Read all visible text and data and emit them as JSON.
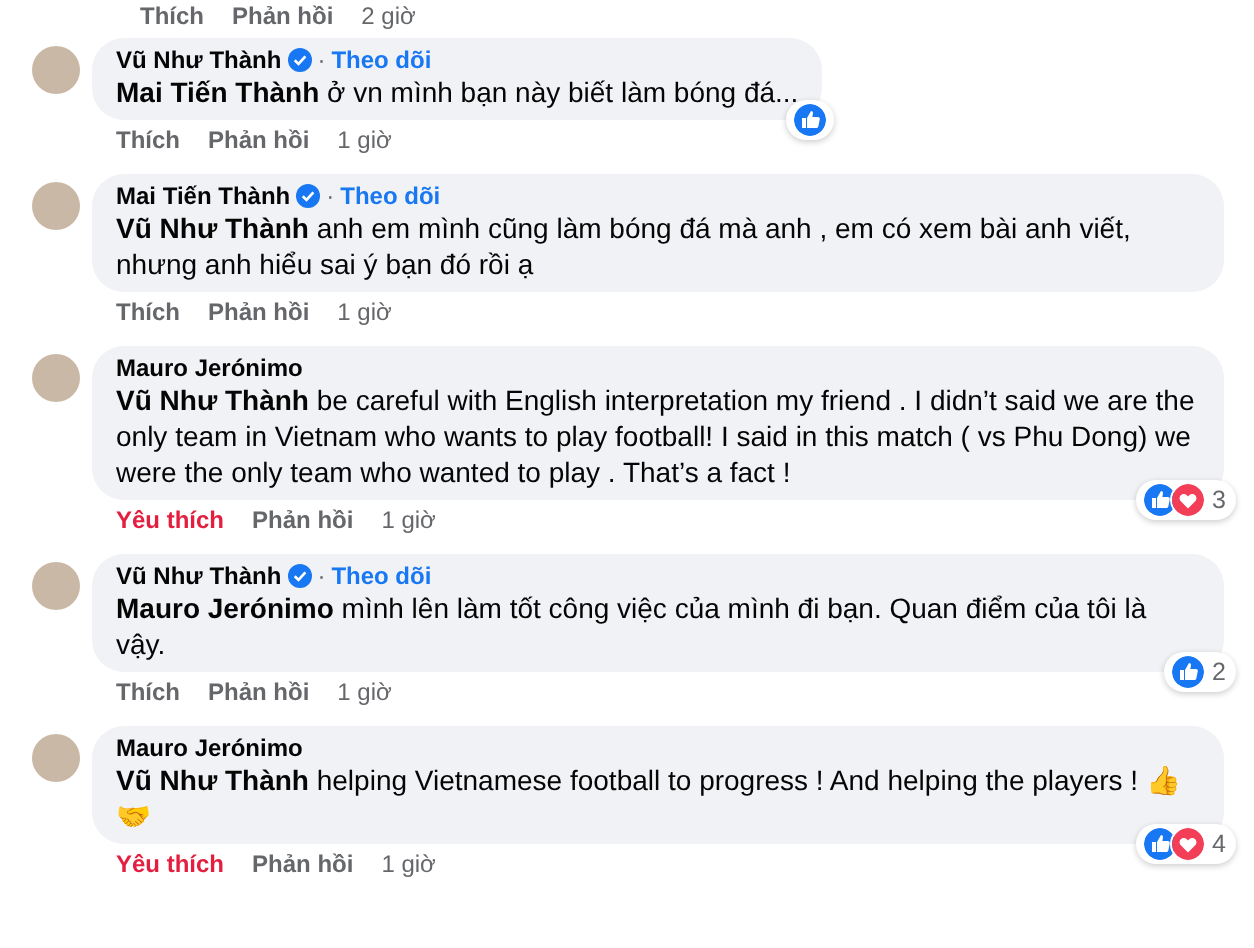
{
  "top_actions": {
    "like_label": "Thích",
    "like_active": false,
    "reply_label": "Phản hồi",
    "time": "2 giờ"
  },
  "comments": [
    {
      "author": "Vũ Như Thành",
      "verified": true,
      "separator": "·",
      "follow_label": "Theo dõi",
      "text": "**Mai Tiến Thành** ở vn mình bạn này biết làm bóng đá...",
      "actions": {
        "like_label": "Thích",
        "like_active": false,
        "reply_label": "Phản hồi",
        "time": "1 giờ"
      },
      "reactions": [
        {
          "kind": "like"
        }
      ]
    },
    {
      "author": "Mai Tiến Thành",
      "verified": true,
      "separator": "·",
      "follow_label": "Theo dõi",
      "text": "**Vũ Như Thành** anh em mình cũng làm bóng đá mà anh , em có xem bài anh viết, nhưng anh hiểu sai ý bạn đó rồi ạ",
      "actions": {
        "like_label": "Thích",
        "like_active": false,
        "reply_label": "Phản hồi",
        "time": "1 giờ"
      }
    },
    {
      "author": "Mauro Jerónimo",
      "verified": false,
      "text": "**Vũ Như Thành** be careful with English interpretation my friend . I didn’t said we are the only team in Vietnam who wants to play football! I said in this match ( vs Phu Dong) we were the only team who wanted to play . That’s a fact !",
      "actions": {
        "like_label": "Yêu thích",
        "like_active": true,
        "reply_label": "Phản hồi",
        "time": "1 giờ"
      },
      "reactions": [
        {
          "kind": "like"
        },
        {
          "kind": "love"
        }
      ],
      "reaction_count": "3"
    },
    {
      "author": "Vũ Như Thành",
      "verified": true,
      "separator": "·",
      "follow_label": "Theo dõi",
      "text": "**Mauro Jerónimo** mình lên làm tốt công việc của mình đi bạn. Quan điểm của tôi là vậy.",
      "actions": {
        "like_label": "Thích",
        "like_active": false,
        "reply_label": "Phản hồi",
        "time": "1 giờ"
      },
      "reactions": [
        {
          "kind": "like"
        }
      ],
      "reaction_count": "2"
    },
    {
      "author": "Mauro Jerónimo",
      "verified": false,
      "text": "**Vũ Như Thành** helping Vietnamese football to progress ! And helping the players ! 👍🤝",
      "actions": {
        "like_label": "Yêu thích",
        "like_active": true,
        "reply_label": "Phản hồi",
        "time": "1 giờ"
      },
      "reactions": [
        {
          "kind": "like"
        },
        {
          "kind": "love"
        }
      ],
      "reaction_count": "4"
    }
  ]
}
